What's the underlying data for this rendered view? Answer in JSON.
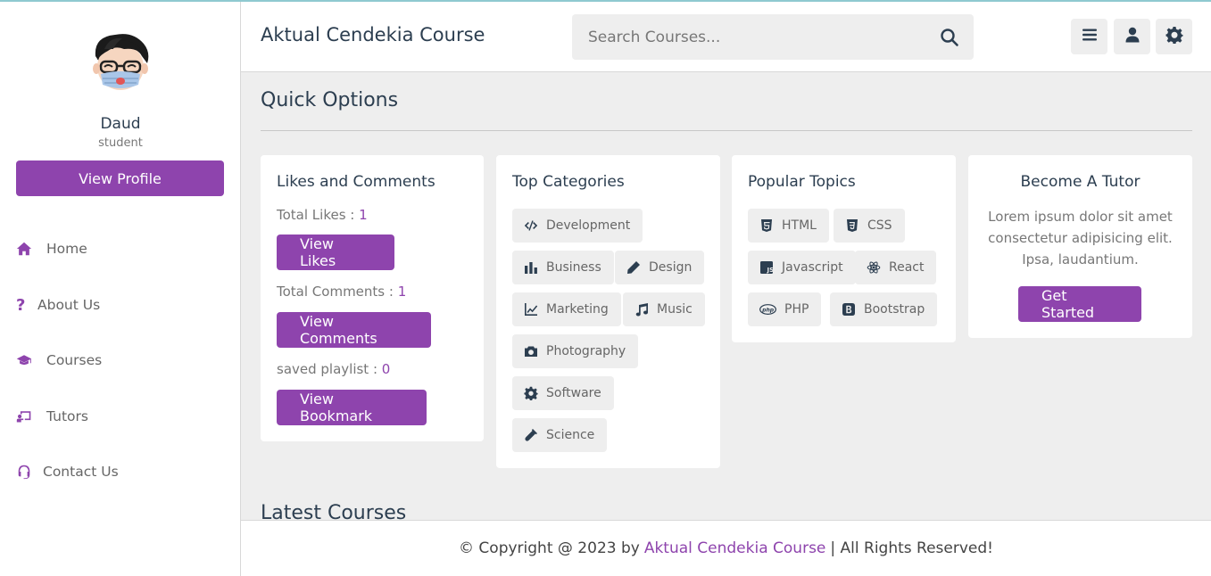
{
  "header": {
    "brand": "Aktual Cendekia Course",
    "search_placeholder": "Search Courses...",
    "icons": [
      "menu-icon",
      "user-icon",
      "gear-icon"
    ]
  },
  "sidebar": {
    "user_name": "Daud",
    "user_role": "student",
    "profile_button": "View Profile",
    "nav": [
      {
        "label": "Home",
        "icon": "home-icon"
      },
      {
        "label": "About Us",
        "icon": "question-icon"
      },
      {
        "label": "Courses",
        "icon": "graduation-cap-icon"
      },
      {
        "label": "Tutors",
        "icon": "chalkboard-teacher-icon"
      },
      {
        "label": "Contact Us",
        "icon": "headset-icon"
      }
    ]
  },
  "main": {
    "section_title": "Quick Options",
    "likes_card": {
      "title": "Likes and Comments",
      "likes_label": "Total Likes : ",
      "likes_value": "1",
      "likes_button": "View Likes",
      "comments_label": "Total Comments : ",
      "comments_value": "1",
      "comments_button": "View Comments",
      "playlist_label": "saved playlist : ",
      "playlist_value": "0",
      "bookmark_button": "View Bookmark"
    },
    "categories_card": {
      "title": "Top Categories",
      "tags": [
        {
          "label": "Development",
          "icon": "code-icon"
        },
        {
          "label": "Business",
          "icon": "bar-chart-icon"
        },
        {
          "label": "Design",
          "icon": "pen-icon"
        },
        {
          "label": "Marketing",
          "icon": "line-chart-icon"
        },
        {
          "label": "Music",
          "icon": "music-icon"
        },
        {
          "label": "Photography",
          "icon": "camera-icon"
        },
        {
          "label": "Software",
          "icon": "cog-icon"
        },
        {
          "label": "Science",
          "icon": "vial-icon"
        }
      ]
    },
    "topics_card": {
      "title": "Popular Topics",
      "tags": [
        {
          "label": "HTML",
          "icon": "html5-icon"
        },
        {
          "label": "CSS",
          "icon": "css3-icon"
        },
        {
          "label": "Javascript",
          "icon": "js-icon"
        },
        {
          "label": "React",
          "icon": "react-icon"
        },
        {
          "label": "PHP",
          "icon": "php-icon"
        },
        {
          "label": "Bootstrap",
          "icon": "bootstrap-icon"
        }
      ]
    },
    "tutor_card": {
      "title": "Become A Tutor",
      "text": "Lorem ipsum dolor sit amet consectetur adipisicing elit. Ipsa, laudantium.",
      "button": "Get Started"
    },
    "latest_title": "Latest Courses"
  },
  "footer": {
    "prefix": "© Copyright @ 2023 by",
    "brand": "Aktual Cendekia Course",
    "suffix": "| All Rights Reserved!"
  },
  "colors": {
    "accent": "#8e44ad",
    "text": "#2c3e50",
    "background": "#eeeeee"
  }
}
